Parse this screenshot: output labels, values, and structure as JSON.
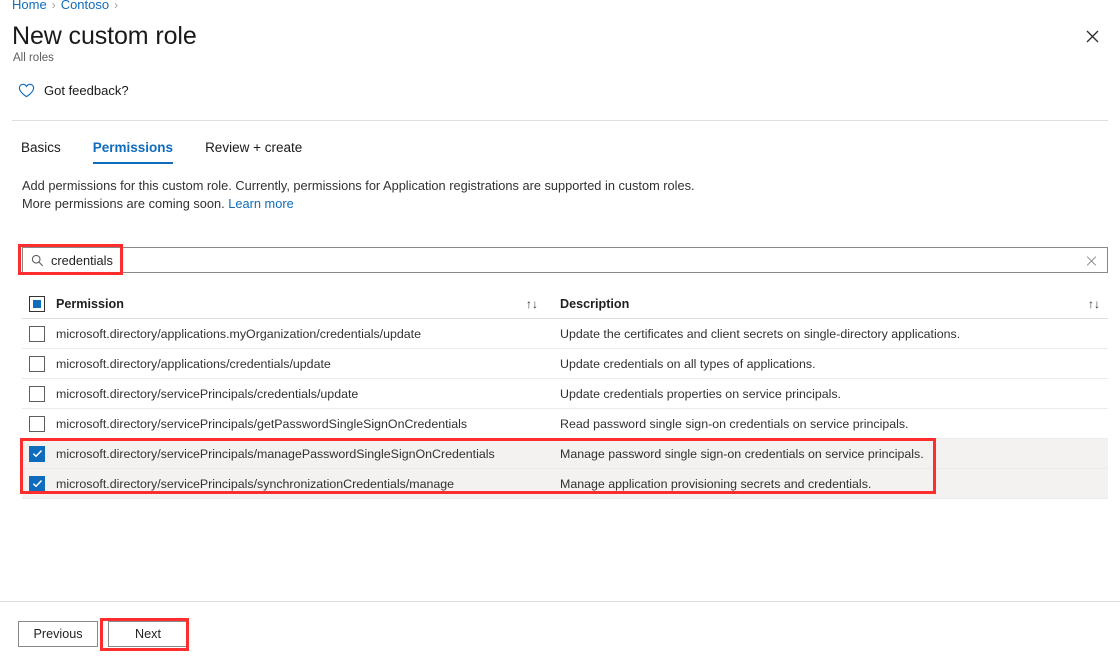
{
  "breadcrumb": {
    "items": [
      "Home",
      "Contoso"
    ],
    "separator": "›"
  },
  "header": {
    "title": "New custom role",
    "subtitle": "All roles",
    "close_label": "✕",
    "close_icon": "close-icon"
  },
  "feedback": {
    "label": "Got feedback?",
    "icon": "heart-icon"
  },
  "tabs": [
    {
      "label": "Basics",
      "active": false
    },
    {
      "label": "Permissions",
      "active": true
    },
    {
      "label": "Review + create",
      "active": false
    }
  ],
  "description": {
    "text": "Add permissions for this custom role. Currently, permissions for Application registrations are supported in custom roles. More permissions are coming soon. ",
    "link": "Learn more"
  },
  "search": {
    "value": "credentials",
    "placeholder": "Search",
    "icon": "search-icon",
    "clear_icon": "close-icon",
    "clear_label": "✕"
  },
  "table": {
    "columns": {
      "permission": "Permission",
      "description": "Description"
    },
    "sort_glyph": "↑↓",
    "header_checkbox_state": "indeterminate",
    "check_glyph": "✓",
    "rows": [
      {
        "checked": false,
        "permission": "microsoft.directory/applications.myOrganization/credentials/update",
        "description": "Update the certificates and client secrets on single-directory applications."
      },
      {
        "checked": false,
        "permission": "microsoft.directory/applications/credentials/update",
        "description": "Update credentials on all types of applications."
      },
      {
        "checked": false,
        "permission": "microsoft.directory/servicePrincipals/credentials/update",
        "description": "Update credentials properties on service principals."
      },
      {
        "checked": false,
        "permission": "microsoft.directory/servicePrincipals/getPasswordSingleSignOnCredentials",
        "description": "Read password single sign-on credentials on service principals."
      },
      {
        "checked": true,
        "permission": "microsoft.directory/servicePrincipals/managePasswordSingleSignOnCredentials",
        "description": "Manage password single sign-on credentials on service principals."
      },
      {
        "checked": true,
        "permission": "microsoft.directory/servicePrincipals/synchronizationCredentials/manage",
        "description": "Manage application provisioning secrets and credentials."
      }
    ]
  },
  "footer": {
    "previous_label": "Previous",
    "next_label": "Next"
  },
  "colors": {
    "accent": "#0f6cbd",
    "annotation": "#ff2d2d",
    "selected_row": "#f3f2f1",
    "border": "#e1dfdd"
  }
}
